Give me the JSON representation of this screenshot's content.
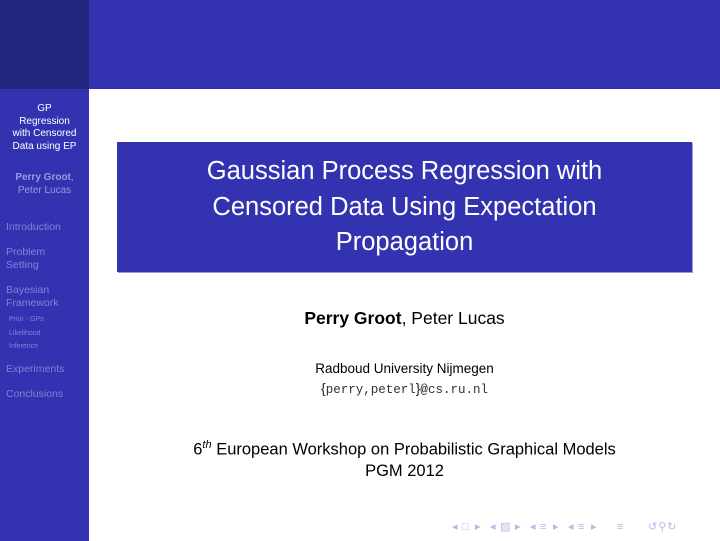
{
  "sidebar": {
    "short_title": [
      "GP",
      "Regression",
      "with Censored",
      "Data using EP"
    ],
    "authors": {
      "presenter": "Perry Groot",
      "separator": ",",
      "coauthor": "Peter Lucas"
    },
    "sections": [
      {
        "label": "Introduction",
        "subsections": []
      },
      {
        "label": "Problem Setting",
        "lines": [
          "Problem",
          "Setting"
        ],
        "subsections": []
      },
      {
        "label": "Bayesian Framework",
        "lines": [
          "Bayesian",
          "Framework"
        ],
        "subsections": [
          "Prior - GPs",
          "Likelihood",
          "Inference"
        ]
      },
      {
        "label": "Experiments",
        "subsections": []
      },
      {
        "label": "Conclusions",
        "subsections": []
      }
    ]
  },
  "slide": {
    "title_lines": [
      "Gaussian Process Regression with",
      "Censored Data Using Expectation",
      "Propagation"
    ],
    "authors": {
      "presenter": "Perry Groot",
      "separator": ",",
      "coauthor": " Peter Lucas"
    },
    "institution": "Radboud University Nijmegen",
    "email": {
      "open": "{",
      "users": "perry,peterl",
      "close": "}",
      "at": "@",
      "domain": "cs.ru.nl"
    },
    "conference": {
      "ordinal": "6",
      "ordinal_suffix": "th",
      "name": " European Workshop on Probabilistic Graphical Models",
      "short": "PGM 2012"
    }
  },
  "navigation": {
    "icons": [
      "nav-left-arrow",
      "frame-icon",
      "nav-right-arrow",
      "nav-left-arrow",
      "subsection-icon",
      "nav-right-arrow",
      "nav-left-arrow",
      "section-icon",
      "nav-right-arrow",
      "nav-left-arrow",
      "subsection-list-icon",
      "nav-right-arrow",
      "outline-icon",
      "search-back-forward-icon"
    ]
  },
  "colors": {
    "beamer_blue": "#3333b2",
    "corner_dark": "#23267e",
    "sidebar_highlight": "#9a9ade",
    "sidebar_muted": "#8282d6",
    "nav_symbols": "#b8b8e8"
  }
}
